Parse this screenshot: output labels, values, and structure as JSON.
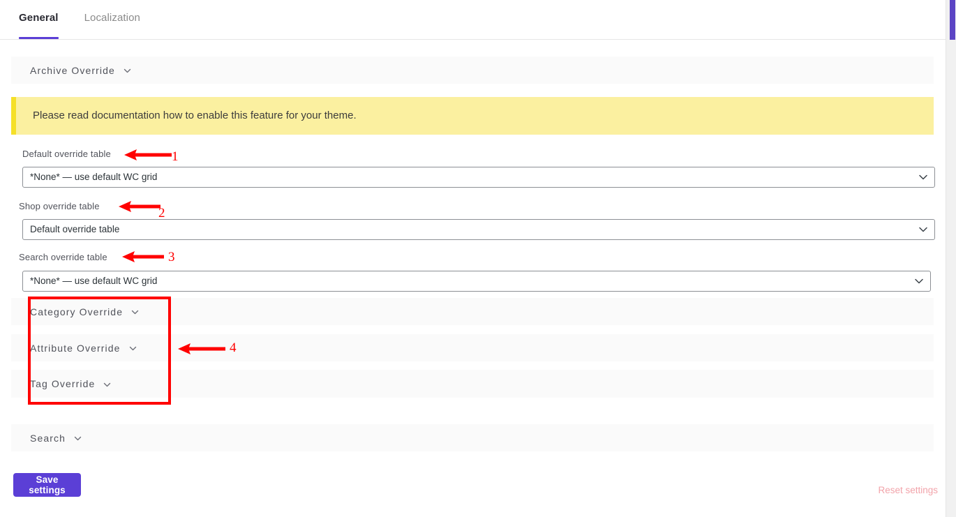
{
  "tabs": [
    {
      "label": "General",
      "active": true
    },
    {
      "label": "Localization",
      "active": false
    }
  ],
  "archive_section": {
    "title": "Archive Override",
    "chevron_icon": "chevron-down-icon"
  },
  "notice": {
    "text": "Please read documentation how to enable this feature for your theme.",
    "background": "#fbf0a0",
    "accent": "#f5e028"
  },
  "fields": [
    {
      "label": "Default override table",
      "value": "*None* — use default WC grid",
      "options": [
        "*None* — use default WC grid",
        "Default override table"
      ]
    },
    {
      "label": "Shop override table",
      "value": "Default override table",
      "options": [
        "Default override table",
        "*None* — use default WC grid"
      ]
    },
    {
      "label": "Search override table",
      "value": "*None* — use default WC grid",
      "options": [
        "*None* — use default WC grid",
        "Default override table"
      ]
    }
  ],
  "override_sections": [
    {
      "title": "Category Override",
      "chevron_icon": "chevron-down-icon"
    },
    {
      "title": "Attribute Override",
      "chevron_icon": "chevron-down-icon"
    },
    {
      "title": "Tag Override",
      "chevron_icon": "chevron-down-icon"
    }
  ],
  "search_section": {
    "title": "Search",
    "chevron_icon": "chevron-down-icon"
  },
  "footer": {
    "save_label": "Save settings",
    "reset_label": "Reset settings",
    "save_color": "#5b3fd6",
    "reset_color": "#f2a3aa"
  },
  "annotations": {
    "color": "#ff0000",
    "markers": [
      {
        "number": "1",
        "target": "Default override table"
      },
      {
        "number": "2",
        "target": "Shop override table"
      },
      {
        "number": "3",
        "target": "Search override table"
      },
      {
        "number": "4",
        "target": "Category / Attribute / Tag Override group"
      }
    ]
  },
  "scrollbar": {
    "thumb_color": "#5b44c4",
    "track_color": "#f1f1f1"
  }
}
